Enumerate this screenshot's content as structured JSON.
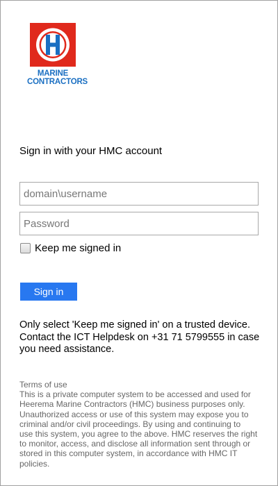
{
  "logo": {
    "letter": "H",
    "line1": "MARINE",
    "line2": "CONTRACTORS",
    "colors": {
      "box": "#e0291c",
      "ring": "#ffffff",
      "letter": "#1a6fc2"
    }
  },
  "form": {
    "heading": "Sign in with your HMC account",
    "username_placeholder": "domain\\username",
    "password_placeholder": "Password",
    "keep_signed_in_label": "Keep me signed in",
    "keep_signed_in_checked": false,
    "signin_label": "Sign in",
    "signin_color": "#2878f0"
  },
  "notice": {
    "lines": [
      "Only select 'Keep me signed in' on a trusted device.",
      "Contact the ICT Helpdesk on +31 71 5799555 in case",
      "you need assistance."
    ]
  },
  "terms": {
    "title": "Terms of use",
    "lines": [
      "This is a private computer system to be accessed and used for",
      "Heerema Marine Contractors (HMC) business purposes only.",
      "Unauthorized access or use of this system may expose you to",
      "criminal and/or civil proceedings. By using and continuing to",
      "use this system, you agree to the above. HMC reserves the right",
      "to monitor, access, and disclose all information sent through or",
      "stored in this computer system, in accordance with HMC IT",
      "policies."
    ]
  }
}
